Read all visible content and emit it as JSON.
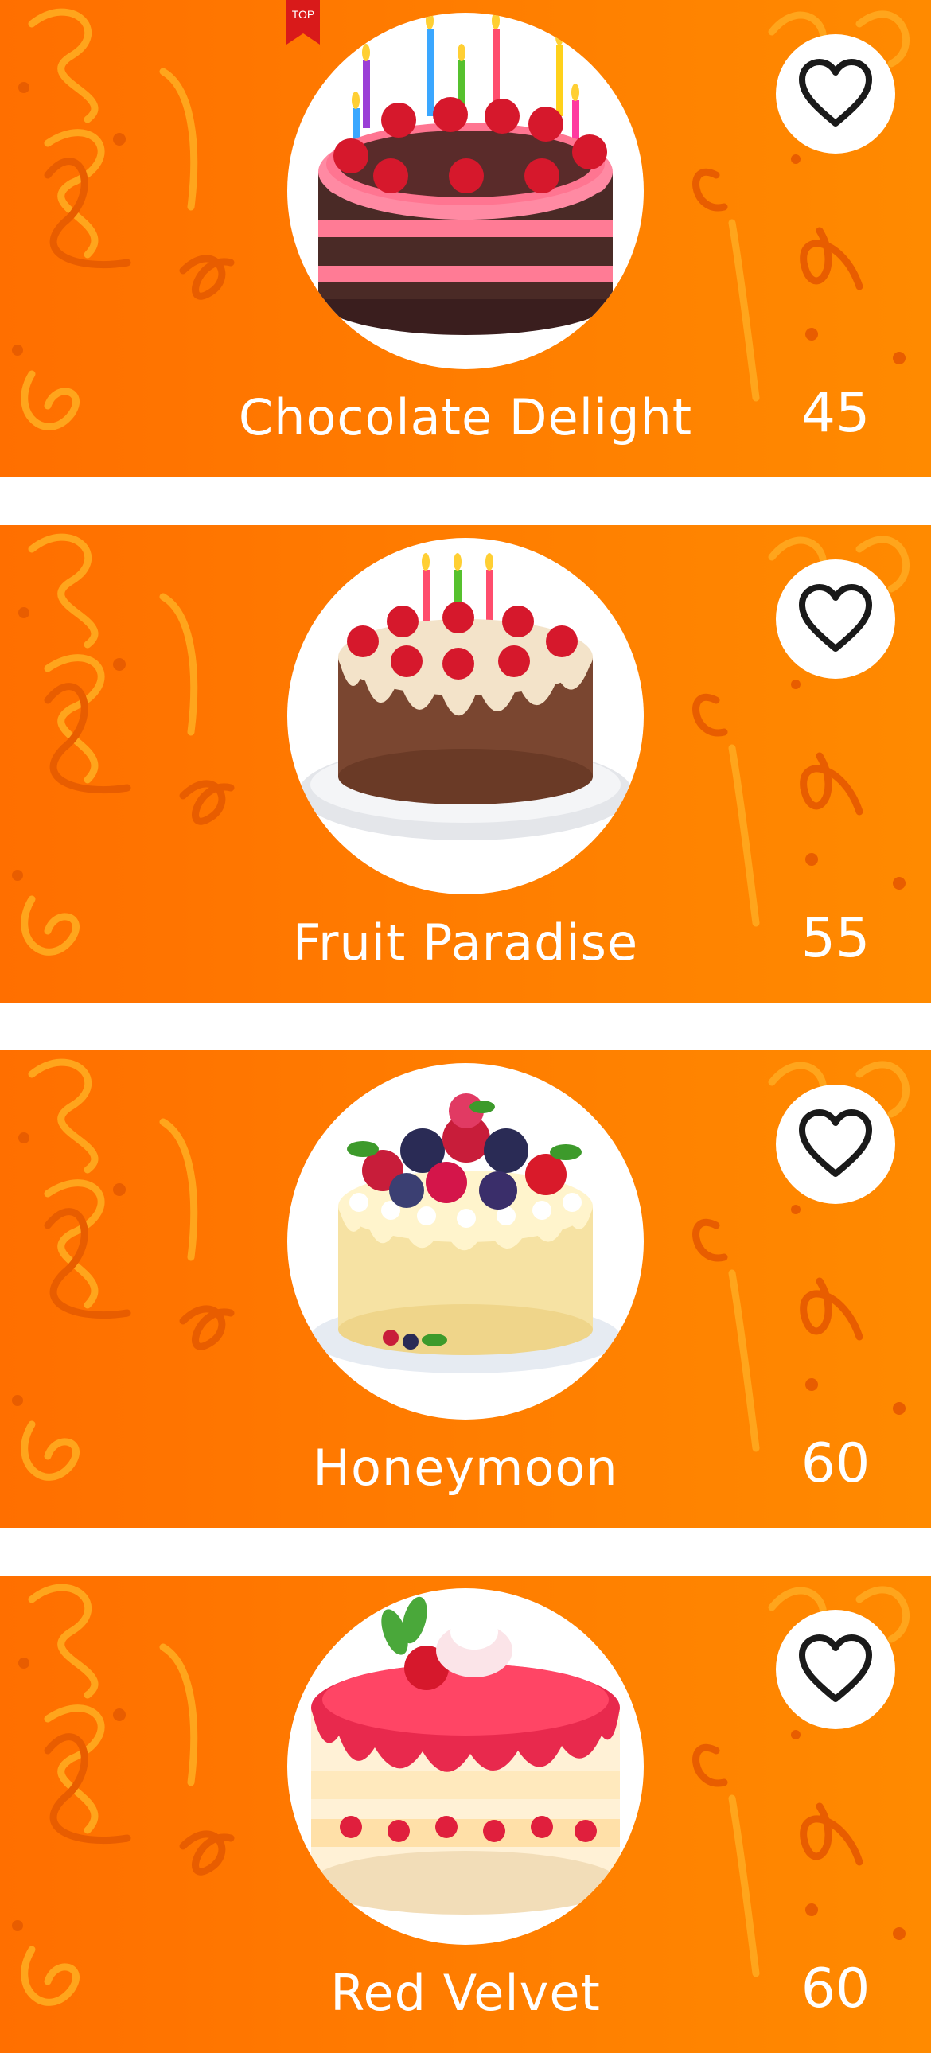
{
  "badge": {
    "label": "TOP"
  },
  "colors": {
    "card_bg_start": "#ff6f00",
    "card_bg_end": "#ff8a00",
    "text": "#ffffff",
    "heart_outline": "#1a1a1a"
  },
  "cakes": [
    {
      "name": "Chocolate Delight",
      "price": "45",
      "image": "chocolate-cake-with-strawberries-and-candles",
      "favorite_icon": "heart-outline-icon"
    },
    {
      "name": "Fruit Paradise",
      "price": "55",
      "image": "cream-cake-with-strawberries-and-candles",
      "favorite_icon": "heart-outline-icon"
    },
    {
      "name": "Honeymoon",
      "price": "60",
      "image": "vanilla-cake-with-mixed-berries",
      "favorite_icon": "heart-outline-icon"
    },
    {
      "name": "Red Velvet",
      "price": "60",
      "image": "strawberry-jelly-cake-with-cream",
      "favorite_icon": "heart-outline-icon"
    }
  ]
}
